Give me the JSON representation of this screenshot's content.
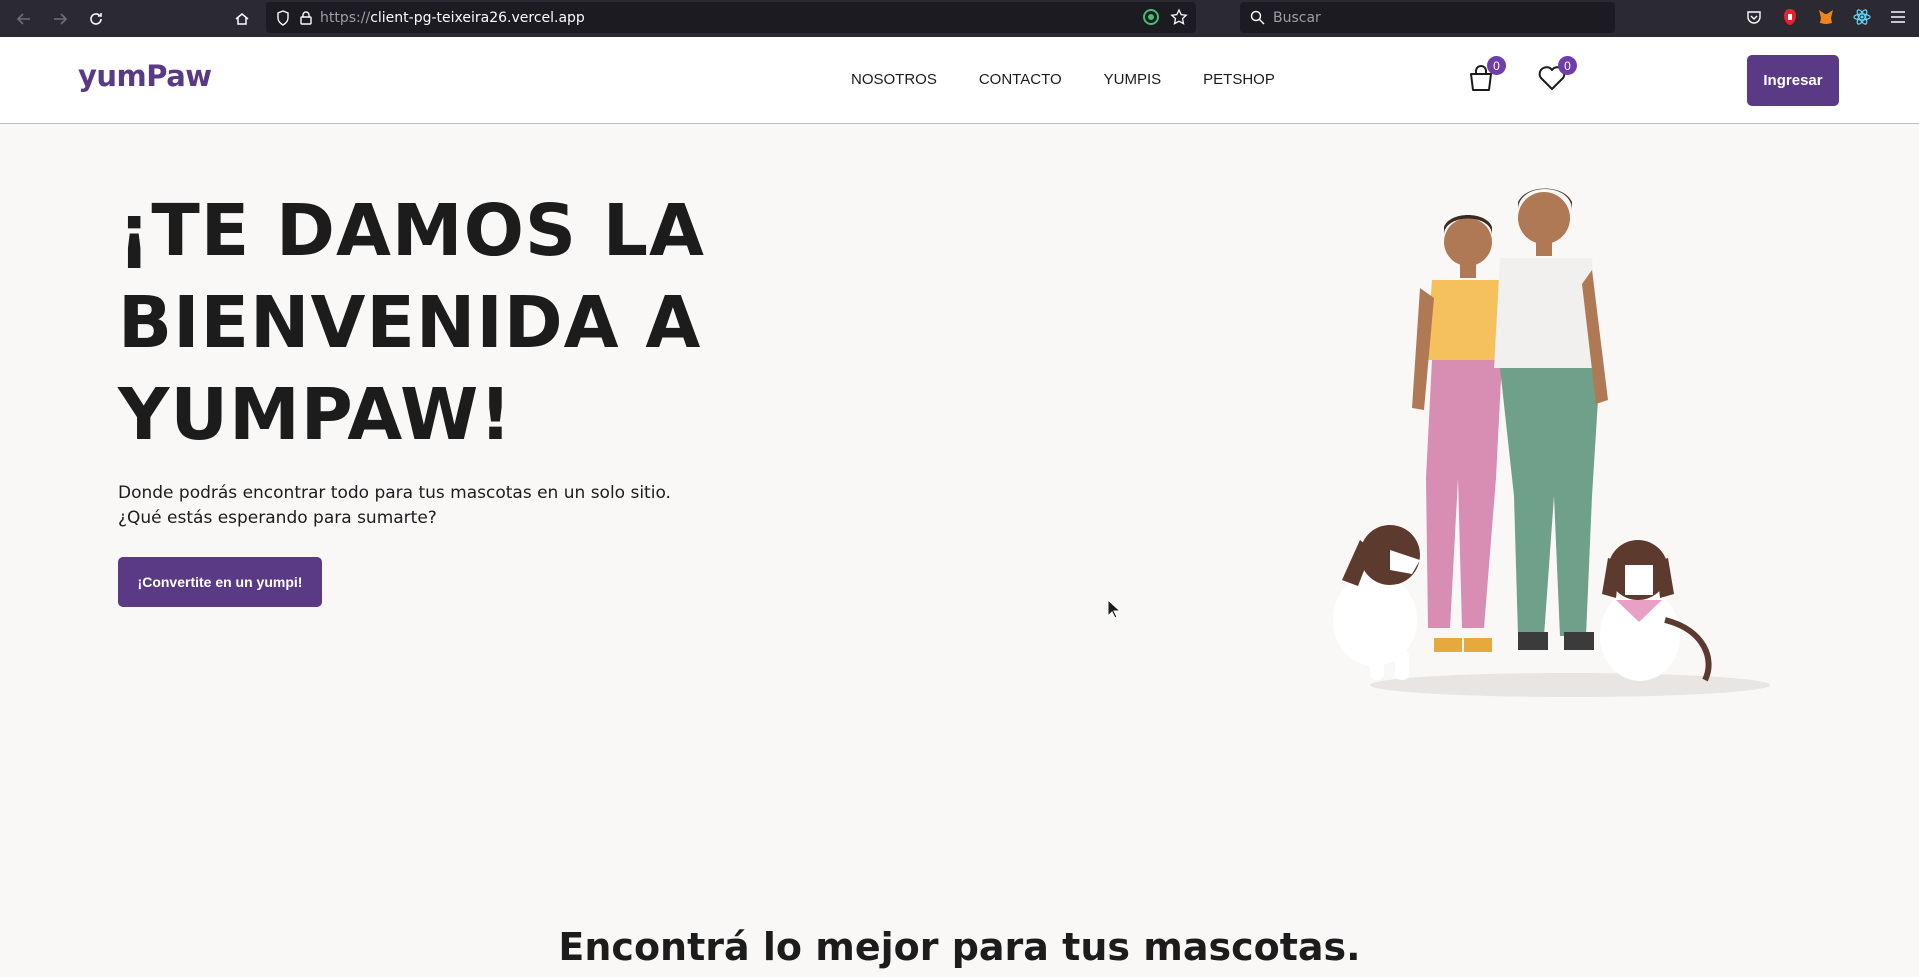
{
  "browser": {
    "url_scheme": "https://",
    "url_host": "client-pg-teixeira26.vercel.app",
    "search_placeholder": "Buscar"
  },
  "header": {
    "logo": "yumPaw",
    "nav": [
      "NOSOTROS",
      "CONTACTO",
      "YUMPIS",
      "PETSHOP"
    ],
    "cart_count": "0",
    "favorites_count": "0",
    "login_label": "Ingresar"
  },
  "hero": {
    "title_lines": [
      "¡TE DAMOS LA",
      "BIENVENIDA A",
      "YUMPAW!"
    ],
    "subtitle_lines": [
      "Donde podrás encontrar todo para tus mascotas en un solo sitio.",
      "¿Qué estás esperando para sumarte?"
    ],
    "cta_label": "¡Convertite en un yumpi!"
  },
  "sections": {
    "products_title": "Encontrá lo mejor para tus mascotas."
  },
  "colors": {
    "brand": "#5a3a85",
    "badge": "#6f3ea8",
    "background": "#faf8f7"
  }
}
